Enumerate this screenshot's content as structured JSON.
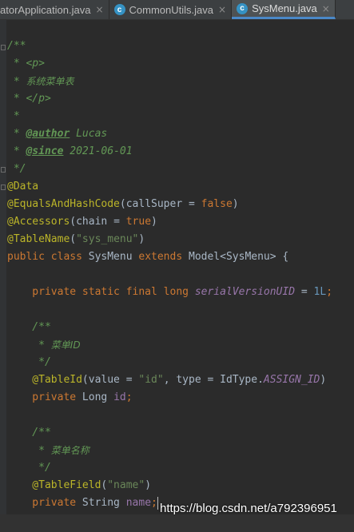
{
  "tabs": [
    {
      "label": "atorApplication.java",
      "active": false,
      "icon": "none"
    },
    {
      "label": "CommonUtils.java",
      "active": false,
      "icon": "class-icon"
    },
    {
      "label": "SysMenu.java",
      "active": true,
      "icon": "class-icon"
    }
  ],
  "tab_close_glyph": "×",
  "class_icon_letter": "c",
  "code": {
    "l1": "/**",
    "l2a": " * ",
    "l2b": "<p>",
    "l3a": " * ",
    "l3b": "系统菜单表",
    "l4a": " * ",
    "l4b": "</p>",
    "l5": " *",
    "l6a": " * ",
    "l6b": "@author",
    "l6c": " Lucas",
    "l7a": " * ",
    "l7b": "@since",
    "l7c": " 2021-06-01",
    "l8": " */",
    "l9": "@Data",
    "l10a": "@EqualsAndHashCode",
    "l10b": "(callSuper = ",
    "l10c": "false",
    "l10d": ")",
    "l11a": "@Accessors",
    "l11b": "(chain = ",
    "l11c": "true",
    "l11d": ")",
    "l12a": "@TableName",
    "l12b": "(",
    "l12c": "\"sys_menu\"",
    "l12d": ")",
    "l13a": "public class ",
    "l13b": "SysMenu ",
    "l13c": "extends ",
    "l13d": "Model<SysMenu> {",
    "l14a": "    private static final long ",
    "l14b": "serialVersionUID",
    "l14c": " = ",
    "l14d": "1L",
    "l14e": ";",
    "l15": "    /**",
    "l16a": "     * ",
    "l16b": "菜单ID",
    "l17": "     */",
    "l18a": "    @TableId",
    "l18b": "(value = ",
    "l18c": "\"id\"",
    "l18d": ", type = IdType.",
    "l18e": "ASSIGN_ID",
    "l18f": ")",
    "l19a": "    private ",
    "l19b": "Long ",
    "l19c": "id",
    "l19d": ";",
    "l20": "    /**",
    "l21a": "     * ",
    "l21b": "菜单名称",
    "l22": "     */",
    "l23a": "    @TableField",
    "l23b": "(",
    "l23c": "\"name\"",
    "l23d": ")",
    "l24a": "    private ",
    "l24b": "String ",
    "l24c": "name",
    "l24d": ";"
  },
  "watermark": "https://blog.csdn.net/a792396951",
  "colors": {
    "background": "#2b2b2b",
    "comment": "#629755",
    "annotation": "#bbb529",
    "keyword": "#cc7832",
    "string": "#6a8759",
    "number": "#6897bb",
    "field": "#9876aa",
    "plain": "#a9b7c6"
  }
}
